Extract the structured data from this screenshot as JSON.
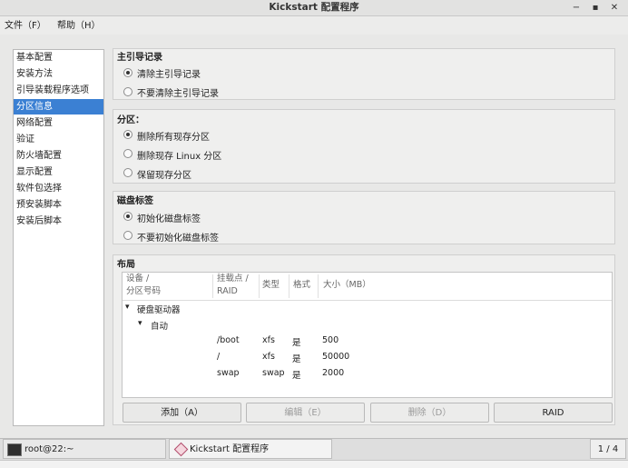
{
  "window": {
    "title": "Kickstart 配置程序",
    "minimize_glyph": "−",
    "maximize_glyph": "▪",
    "close_glyph": "✕"
  },
  "menu": {
    "file": "文件（F）",
    "help": "帮助（H）"
  },
  "sidebar": {
    "items": [
      "基本配置",
      "安装方法",
      "引导装载程序选项",
      "分区信息",
      "网络配置",
      "验证",
      "防火墙配置",
      "显示配置",
      "软件包选择",
      "预安装脚本",
      "安装后脚本"
    ],
    "selected_index": 3
  },
  "mbr": {
    "title": "主引导记录",
    "options": [
      "清除主引导记录",
      "不要清除主引导记录"
    ],
    "selected_index": 0
  },
  "partitions": {
    "title": "分区：",
    "options": [
      "删除所有现存分区",
      "删除现存 Linux 分区",
      "保留现存分区"
    ],
    "selected_index": 0
  },
  "disklabel": {
    "title": "磁盘标签",
    "options": [
      "初始化磁盘标签",
      "不要初始化磁盘标签"
    ],
    "selected_index": 0
  },
  "layout": {
    "title": "布局",
    "columns": {
      "device_line1": "设备 /",
      "device_line2": "分区号码",
      "mount_line1": "挂载点 /",
      "mount_line2": "RAID",
      "type": "类型",
      "format": "格式",
      "size": "大小（MB）"
    },
    "tree": {
      "root": "硬盘驱动器",
      "child": "自动",
      "expander_glyph": "▾"
    },
    "rows": [
      {
        "mount": "/boot",
        "type": "xfs",
        "format": "是",
        "size": "500"
      },
      {
        "mount": "/",
        "type": "xfs",
        "format": "是",
        "size": "50000"
      },
      {
        "mount": "swap",
        "type": "swap",
        "format": "是",
        "size": "2000"
      }
    ]
  },
  "buttons": {
    "add": "添加（A）",
    "edit": "编辑（E）",
    "delete": "删除（D）",
    "raid": "RAID"
  },
  "taskbar": {
    "terminal": "root@22:~",
    "app": "Kickstart 配置程序",
    "workspace": "1 / 4"
  }
}
